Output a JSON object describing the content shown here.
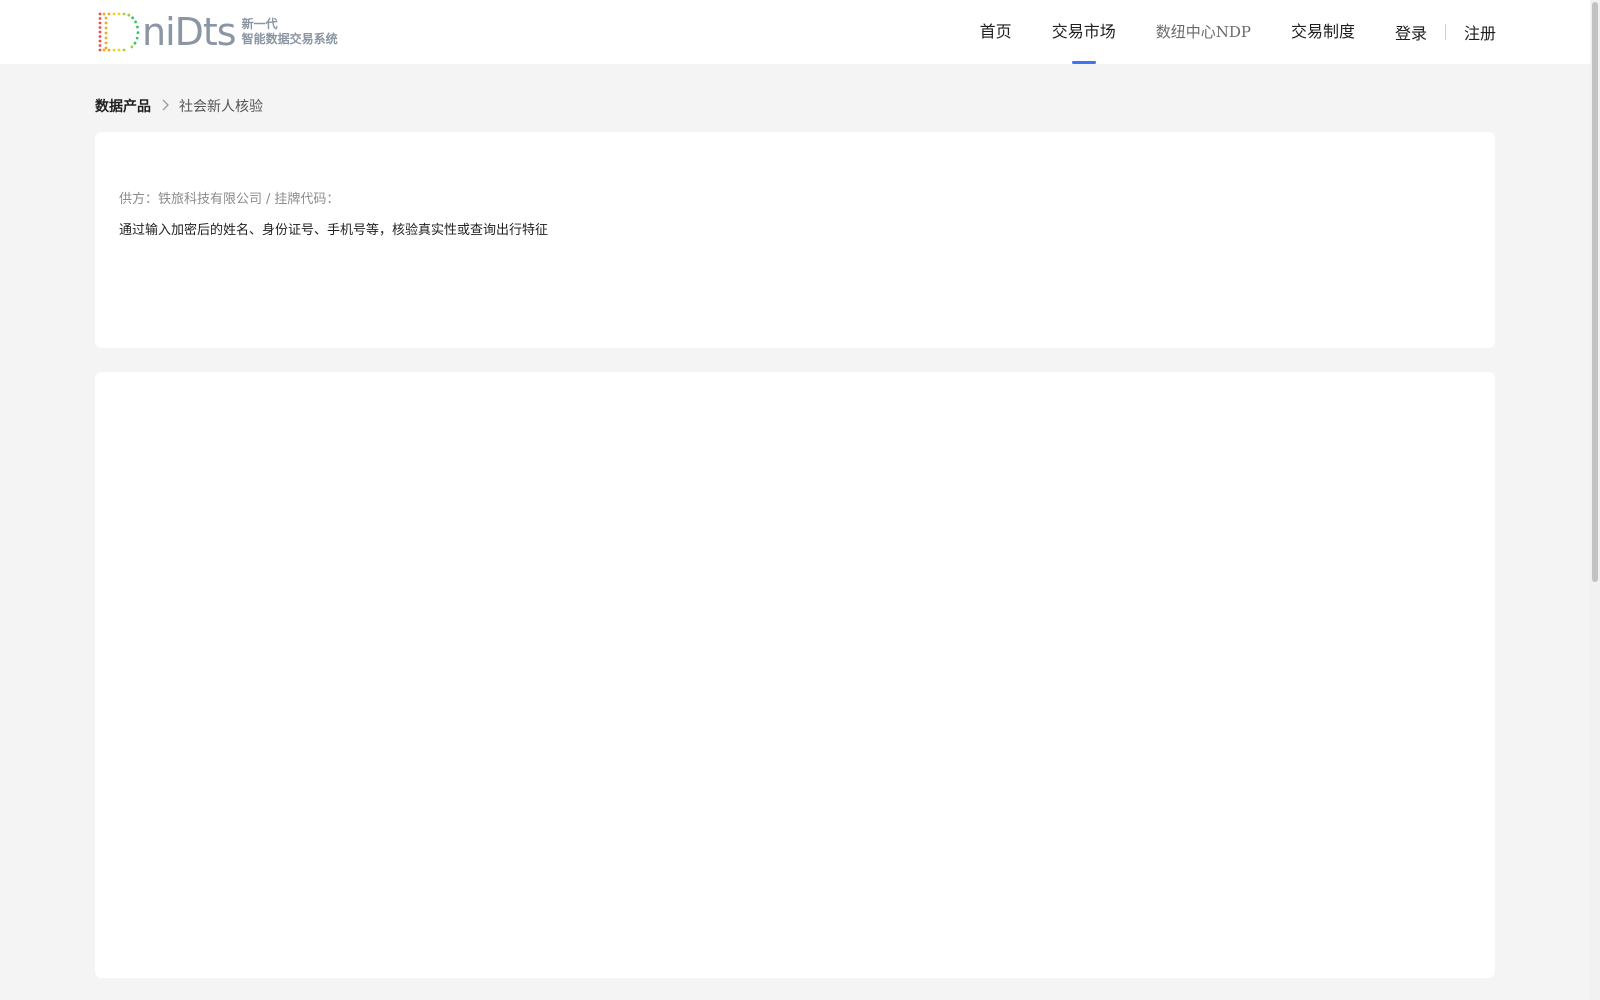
{
  "header": {
    "logo_text": "niDts",
    "logo_sub_line1": "新一代",
    "logo_sub_line2": "智能数据交易系统",
    "nav": [
      {
        "label": "首页"
      },
      {
        "label": "交易市场"
      },
      {
        "label": "数纽中心NDP"
      },
      {
        "label": "交易制度"
      }
    ],
    "login_label": "登录",
    "register_label": "注册",
    "active_color": "#3f73f0"
  },
  "breadcrumb": {
    "root": "数据产品",
    "current": "社会新人核验"
  },
  "product": {
    "supplier_prefix": "供方：",
    "supplier_name": "铁旅科技有限公司",
    "separator": "/",
    "listing_code_label": "挂牌代码：",
    "description": "通过输入加密后的姓名、身份证号、手机号等，核验真实性或查询出行特征"
  }
}
